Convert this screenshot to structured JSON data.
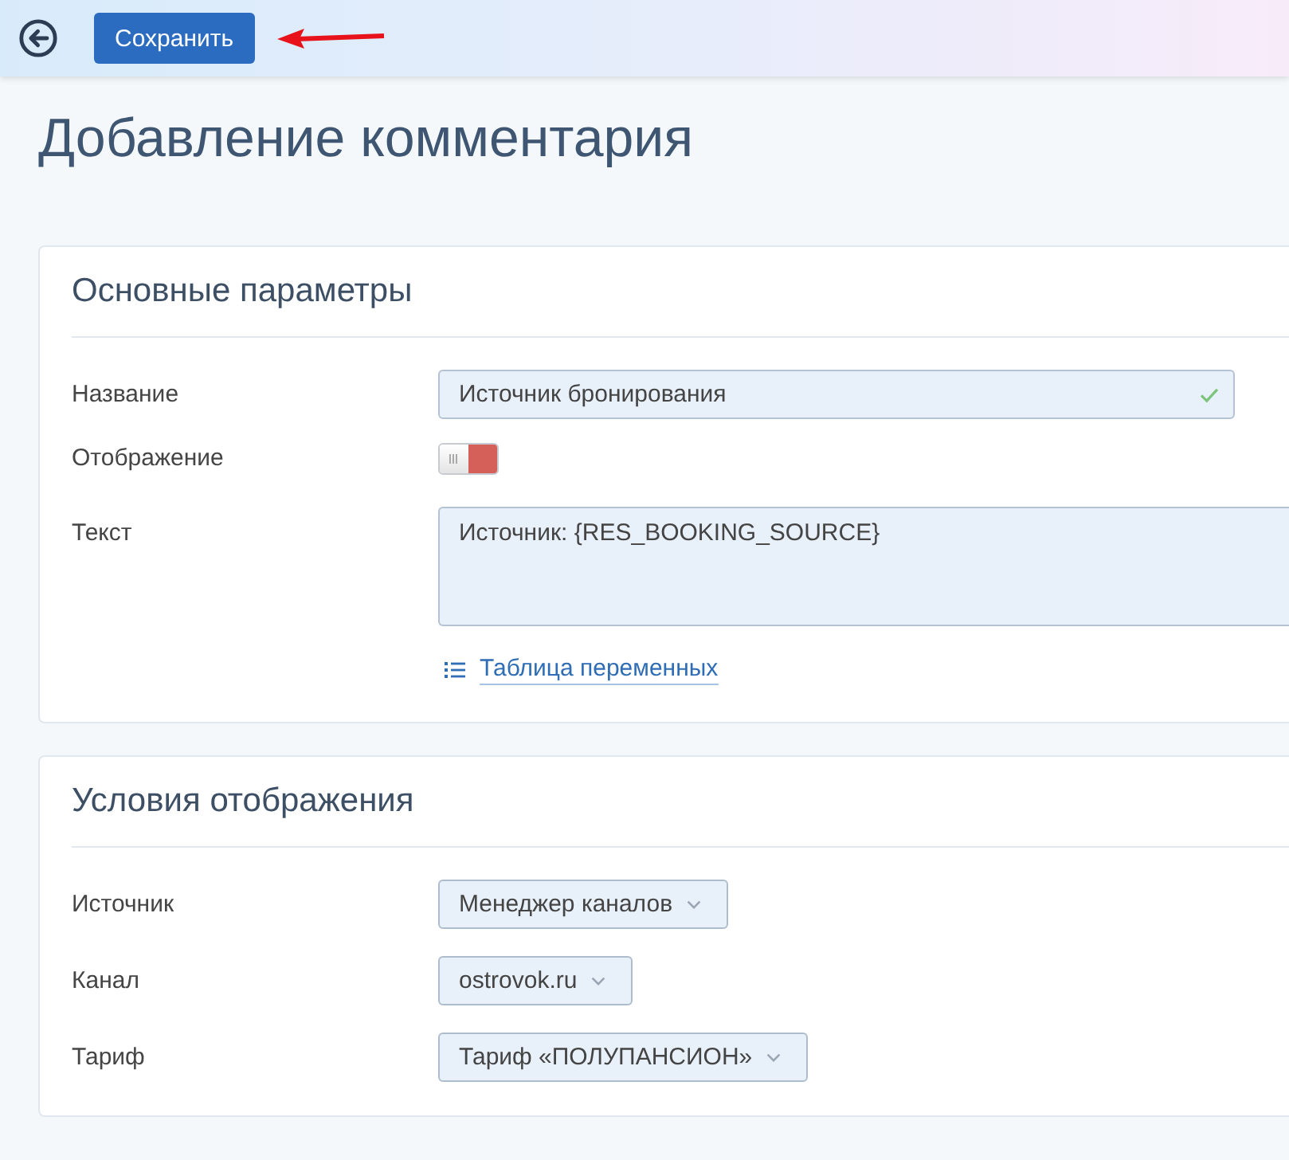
{
  "top_bar": {
    "save_button": "Сохранить"
  },
  "page_title": "Добавление комментария",
  "sections": [
    {
      "title": "Основные параметры",
      "fields": [
        {
          "kind": "text",
          "label": "Название",
          "value": "Источник бронирования",
          "valid": true
        },
        {
          "kind": "toggle",
          "label": "Отображение",
          "on": false
        },
        {
          "kind": "textarea",
          "label": "Текст",
          "value": "Источник: {RES_BOOKING_SOURCE}"
        }
      ],
      "link": "Таблица переменных"
    },
    {
      "title": "Условия отображения",
      "fields": [
        {
          "kind": "select",
          "label": "Источник",
          "value": "Менеджер каналов"
        },
        {
          "kind": "select",
          "label": "Канал",
          "value": "ostrovok.ru"
        },
        {
          "kind": "select",
          "label": "Тариф",
          "value": "Тариф «ПОЛУПАНСИОН»"
        }
      ]
    }
  ]
}
